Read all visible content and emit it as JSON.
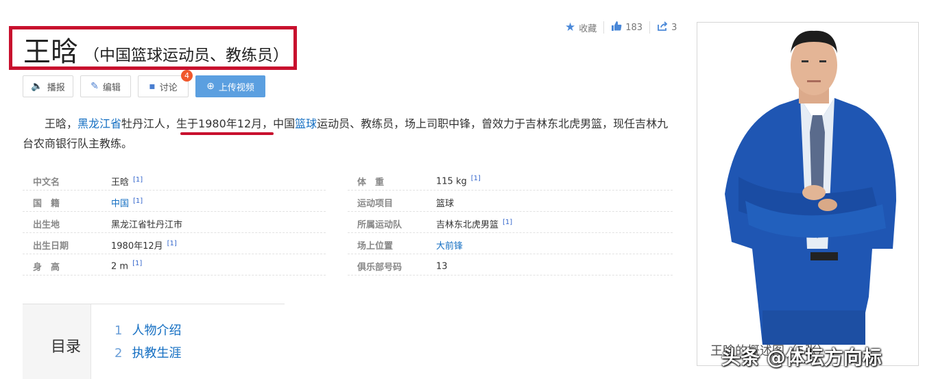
{
  "title": {
    "name": "王晗",
    "subtitle": "（中国篮球运动员、教练员）"
  },
  "stats": {
    "favorite_label": "收藏",
    "likes": "183",
    "shares": "3"
  },
  "actions": {
    "broadcast": "播报",
    "edit": "编辑",
    "discuss": "讨论",
    "discuss_badge": "4",
    "upload_video": "上传视频"
  },
  "summary": {
    "p1": "王晗，",
    "link_province": "黑龙江省",
    "p2": "牡丹江人，",
    "birth": "生于1980年12月",
    "p3": "，中国",
    "link_sport": "篮球",
    "p4": "运动员、教练员，场上司职中锋，曾效力于吉林东北虎男篮，现任吉林九台农商银行队主教练。"
  },
  "info": {
    "left": [
      {
        "key": "中文名",
        "value": "王晗",
        "ref": "[1]"
      },
      {
        "key": "国　籍",
        "value": "中国",
        "ref": "[1]"
      },
      {
        "key": "出生地",
        "value": "黑龙江省牡丹江市",
        "ref": ""
      },
      {
        "key": "出生日期",
        "value": "1980年12月",
        "ref": "[1]"
      },
      {
        "key": "身　高",
        "value": "2 m",
        "ref": "[1]"
      }
    ],
    "right": [
      {
        "key": "体　重",
        "value": "115 kg",
        "ref": "[1]"
      },
      {
        "key": "运动项目",
        "value": "篮球",
        "ref": ""
      },
      {
        "key": "所属运动队",
        "value": "吉林东北虎男篮",
        "ref": "[1]"
      },
      {
        "key": "场上位置",
        "value": "大前锋",
        "ref": ""
      },
      {
        "key": "俱乐部号码",
        "value": "13",
        "ref": ""
      }
    ]
  },
  "toc": {
    "label": "目录",
    "items": [
      {
        "num": "1",
        "label": "人物介绍"
      },
      {
        "num": "2",
        "label": "执教生涯"
      }
    ]
  },
  "photo": {
    "caption": "王晗的概述图（5张）",
    "watermark": "头条 @体坛方向标"
  },
  "colors": {
    "accent_blue": "#136ec2",
    "highlight_red": "#c8102e",
    "suit_blue": "#1f56b3"
  }
}
